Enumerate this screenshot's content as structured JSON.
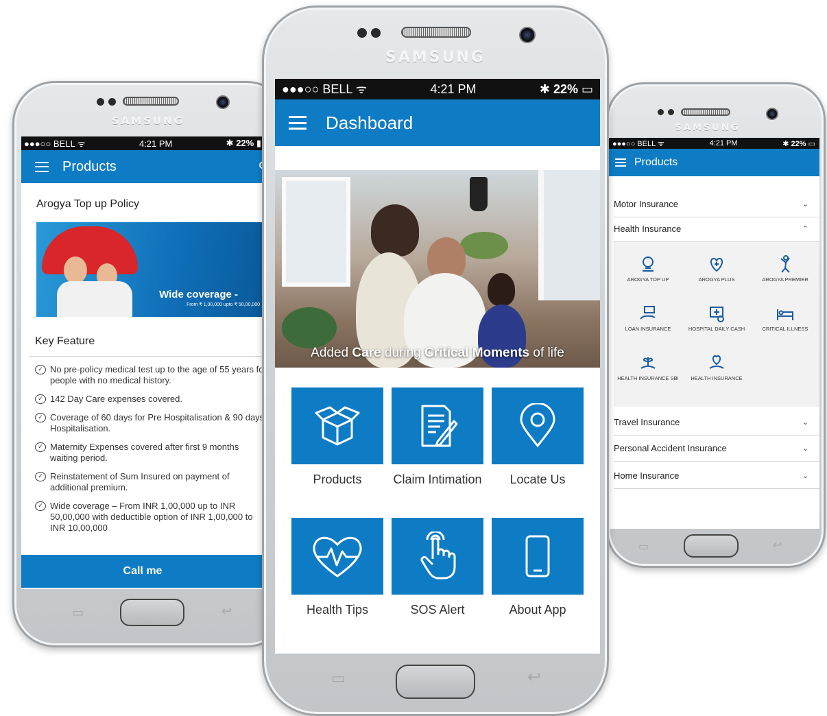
{
  "status_bar": {
    "carrier": "●●●○○ BELL ᯤ",
    "time": "4:21 PM",
    "battery": "22%"
  },
  "brand": "SAMSUNG",
  "colors": {
    "accent": "#0e7cc4",
    "status_bar": "#111111"
  },
  "center": {
    "title": "Dashboard",
    "hero_caption": {
      "pre": "Added ",
      "care": "Care",
      "mid": " during ",
      "critical": "Critical Moments",
      "post": " of life"
    },
    "tiles": [
      {
        "label": "Products",
        "icon": "box-icon"
      },
      {
        "label": "Claim Intimation",
        "icon": "document-edit-icon"
      },
      {
        "label": "Locate Us",
        "icon": "location-pin-icon"
      },
      {
        "label": "Health Tips",
        "icon": "heartbeat-icon"
      },
      {
        "label": "SOS Alert",
        "icon": "tap-hand-icon"
      },
      {
        "label": "About App",
        "icon": "smartphone-icon"
      }
    ]
  },
  "left": {
    "title": "Products",
    "policy_title": "Arogya Top up Policy",
    "banner_main": "Wide coverage -",
    "banner_sub": "From ₹ 1,00,000 upto ₹ 50,00,000",
    "key_feature": "Key Feature",
    "features": [
      "No pre-policy medical test up to the age of 55 years for people with no medical history.",
      "142 Day Care expenses covered.",
      "Coverage of 60 days for Pre Hospitalisation & 90 days Hospitalisation.",
      "Maternity Expenses covered after first 9 months waiting period.",
      "Reinstatement of Sum Insured on payment of additional premium.",
      "Wide coverage – From INR 1,00,000 up to INR 50,00,000 with deductible option of INR 1,00,000 to INR 10,00,000"
    ],
    "call_me": "Call me"
  },
  "right": {
    "title": "Products",
    "sections_top": [
      {
        "label": "Motor Insurance",
        "state": "⌄"
      },
      {
        "label": "Health Insurance",
        "state": "⌃"
      }
    ],
    "health_items": [
      {
        "label": "AROGYA TOP UP",
        "icon": "umbrella-shield-icon"
      },
      {
        "label": "AROGYA PLUS",
        "icon": "heart-plus-icon"
      },
      {
        "label": "AROGYA PREMIER",
        "icon": "healthy-person-icon"
      },
      {
        "label": "LOAN INSURANCE",
        "icon": "hand-money-icon"
      },
      {
        "label": "HOSPITAL DAILY CASH",
        "icon": "hospital-cash-icon"
      },
      {
        "label": "CRITICAL ILLNESS",
        "icon": "hospital-bed-icon"
      },
      {
        "label": "HEALTH INSURANCE SBI",
        "icon": "plant-hand-icon"
      },
      {
        "label": "HEALTH INSURANCE",
        "icon": "heart-hand-icon"
      }
    ],
    "sections_bottom": [
      {
        "label": "Travel Insurance",
        "state": "⌄"
      },
      {
        "label": "Personal Accident Insurance",
        "state": "⌄"
      },
      {
        "label": "Home Insurance",
        "state": "⌄"
      }
    ]
  }
}
